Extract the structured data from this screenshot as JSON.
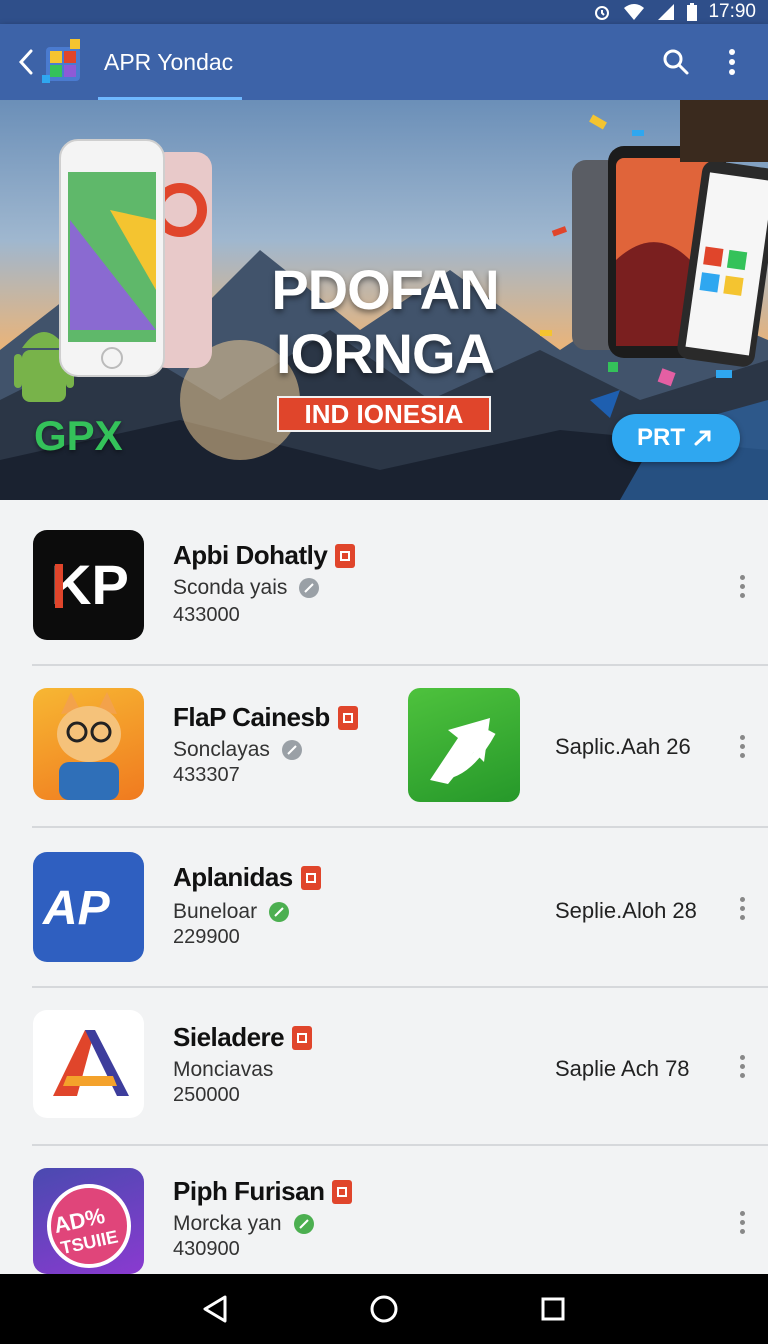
{
  "status_bar": {
    "time": "17:90"
  },
  "app_bar": {
    "title": "APR Yondac"
  },
  "banner": {
    "title_line1": "PDOFAN",
    "title_line2": "IORNGA",
    "tag": "IND IONESIA",
    "brand": "GPX",
    "cta_label": "PRT"
  },
  "apps": [
    {
      "name": "Apbi Dohatly",
      "subtitle": "Sconda yais",
      "count": "433000",
      "meta": ""
    },
    {
      "name": "FlaP Cainesb",
      "subtitle": "Sonclayas",
      "count": "433307",
      "meta": "Saplic.Aah 26"
    },
    {
      "name": "Aplanidas",
      "subtitle": "Buneloar",
      "count": "229900",
      "meta": "Seplie.Aloh 28"
    },
    {
      "name": "Sieladere",
      "subtitle": "Monciavas",
      "count": "250000",
      "meta": "Saplie Ach 78"
    },
    {
      "name": "Piph Furisan",
      "subtitle": "Morcka yan",
      "count": "430900",
      "meta": ""
    }
  ],
  "icons": {
    "app1": "kp-logo",
    "app2": "cat-mascot",
    "app3": "ap-logo",
    "app4": "a-triangle-logo",
    "app5": "ad-sticker"
  }
}
